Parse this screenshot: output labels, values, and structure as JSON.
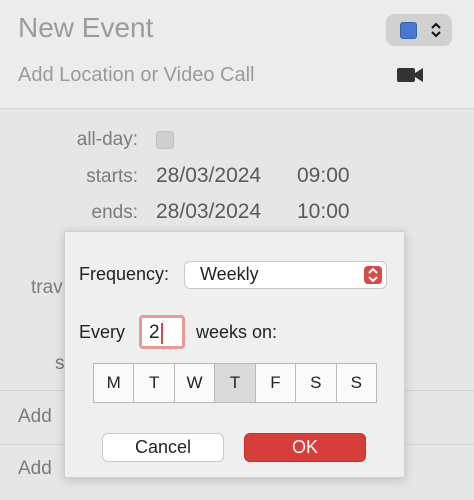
{
  "header": {
    "title": "New Event",
    "location_placeholder": "Add Location or Video Call",
    "calendar_color": "#4a78d0"
  },
  "details": {
    "all_day_label": "all-day:",
    "starts_label": "starts:",
    "starts_date": "28/03/2024",
    "starts_time": "09:00",
    "ends_label": "ends:",
    "ends_date": "28/03/2024",
    "ends_time": "10:00",
    "partial_labels": [
      "trav",
      "s"
    ],
    "add_rows": [
      "Add",
      "Add"
    ]
  },
  "dialog": {
    "frequency_label": "Frequency:",
    "frequency_value": "Weekly",
    "every_label": "Every",
    "every_value": "2",
    "weeks_label": "weeks on:",
    "days": [
      {
        "label": "M",
        "selected": false
      },
      {
        "label": "T",
        "selected": false
      },
      {
        "label": "W",
        "selected": false
      },
      {
        "label": "T",
        "selected": true
      },
      {
        "label": "F",
        "selected": false
      },
      {
        "label": "S",
        "selected": false
      },
      {
        "label": "S",
        "selected": false
      }
    ],
    "cancel_label": "Cancel",
    "ok_label": "OK"
  },
  "colors": {
    "accent": "#d93d39"
  }
}
